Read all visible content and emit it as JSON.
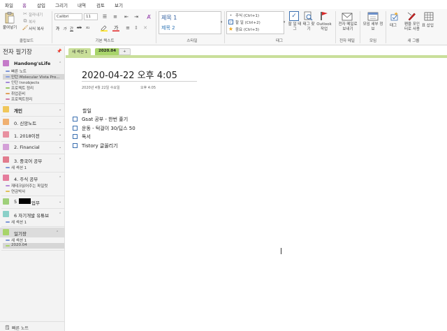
{
  "menu": [
    "파일",
    "홈",
    "삽입",
    "그리기",
    "내역",
    "검토",
    "보기"
  ],
  "ribbon": {
    "clipboard": {
      "paste": "붙여넣기",
      "cut": "잘라내기",
      "copy": "복사",
      "format_copy": "서식 복사",
      "label": "클립보드"
    },
    "basic_text": {
      "font": "Calibri",
      "size": "11",
      "label": "기본 텍스트",
      "format_buttons": [
        "가",
        "가",
        "간",
        "ab",
        "x₂"
      ]
    },
    "styles": {
      "items": [
        "제목 1",
        "제목 2"
      ],
      "label": "스타일"
    },
    "tags": {
      "items": [
        "주식 (Ctrl+1)",
        "할 일 (Ctrl+2)",
        "중요 (Ctrl+3)"
      ],
      "todo_tag": "할 일 태그",
      "find_tags": "태그 찾기",
      "outlook": "Outlook 작업",
      "label": "태그"
    },
    "email": {
      "button": "전자 메일로 보내기",
      "label": "전자 메일"
    },
    "meeting": {
      "button": "모임 세부 정보",
      "label": "모임"
    },
    "new_group": {
      "tag": "태그",
      "pen_tag": "펜을 포인터로 사용",
      "table": "표 삽입",
      "label": "새 그룹"
    }
  },
  "sidebar": {
    "title": "전자 필기장",
    "notebooks": [
      {
        "name": "Handong'sLife",
        "color": "#c57ac9",
        "bold": true,
        "sections": [
          {
            "name": "빠른 노트",
            "color": "#7c95d6"
          },
          {
            "name": "인턴 Molecular Vista Pro...",
            "color": "#8aa0e0",
            "selected": true
          },
          {
            "name": "인턴 Innobjects",
            "color": "#a38ad8"
          },
          {
            "name": "프로젝트 정리",
            "color": "#9ac766"
          },
          {
            "name": "취업준비",
            "color": "#e0a05a"
          },
          {
            "name": "프로젝트정리",
            "color": "#d07aa8"
          }
        ]
      },
      {
        "name": "개인",
        "color": "#f0c75a",
        "bold": true,
        "sections": []
      },
      {
        "name": "0. 신앙노트",
        "color": "#f0b070",
        "sections": []
      },
      {
        "name": "1. 2018이전",
        "color": "#e890a0",
        "sections": []
      },
      {
        "name": "2. Financial",
        "color": "#d4a0d8",
        "sections": []
      },
      {
        "name": "3. 중국어 공부",
        "color": "#e27c8e",
        "sections": [
          {
            "name": "새 섹션 1",
            "color": "#7c95d6"
          }
        ]
      },
      {
        "name": "4. 주식 공부",
        "color": "#e57c9c",
        "sections": [
          {
            "name": "재테크읽어주는 파일럿",
            "color": "#b48ad8"
          },
          {
            "name": "연금박사",
            "color": "#e0c05a"
          }
        ]
      },
      {
        "name": "5",
        "suffix": "업무",
        "color": "#9fd07a",
        "sections": []
      },
      {
        "name": "6 자기개발 유튜브",
        "color": "#8ad0c8",
        "sections": [
          {
            "name": "새 섹션 1",
            "color": "#7c95d6"
          }
        ]
      },
      {
        "name": "일기장",
        "color": "#a8d46a",
        "selected": true,
        "sections": [
          {
            "name": "새 섹션 1",
            "color": "#7c95d6"
          },
          {
            "name": "2020.04",
            "color": "#a8d46a",
            "selected": true
          }
        ]
      }
    ],
    "quick_notes": "빠른 노트"
  },
  "section_tabs": [
    "새 섹션 1",
    "2020.04",
    "+"
  ],
  "page": {
    "title": "2020-04-22 오후 4:05",
    "date": "2020년 4월 22일 수요일",
    "time": "오후 4:05",
    "heading": "할일",
    "todos": [
      {
        "text": "Gsat 공부 - 한번 훑기"
      },
      {
        "text": "운동 - 턱걸이 30/딥스 50"
      },
      {
        "text": "독서"
      },
      {
        "text": "Tistory 글올리기"
      }
    ]
  },
  "colors": {
    "accent": "#7a2a8c",
    "section_green": "#c9df9a",
    "tab_active": "#a8d46a",
    "todo_box": "#3a6fb0"
  }
}
